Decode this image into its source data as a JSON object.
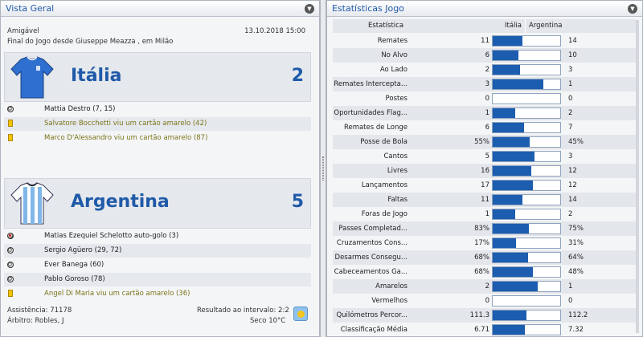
{
  "left": {
    "title": "Vista Geral",
    "competition": "Amigável",
    "datetime": "13.10.2018 15:00",
    "subtitle": "Final do Jogo desde Giuseppe Meazza , em Milão",
    "home": {
      "name": "Itália",
      "score": "2",
      "events": [
        {
          "type": "goal",
          "text": "Mattia Destro (7, 15)"
        },
        {
          "type": "yellow",
          "text": "Salvatore Bocchetti viu um cartão amarelo (42)"
        },
        {
          "type": "yellow",
          "text": "Marco D'Alessandro viu um cartão amarelo (87)"
        }
      ]
    },
    "away": {
      "name": "Argentina",
      "score": "5",
      "events": [
        {
          "type": "owngoal",
          "text": "Matias Ezequiel Schelotto auto-golo (3)"
        },
        {
          "type": "goal",
          "text": "Sergio Agüero (29, 72)"
        },
        {
          "type": "goal",
          "text": "Ever Banega (60)"
        },
        {
          "type": "goal",
          "text": "Pablo Goroso (78)"
        },
        {
          "type": "yellow",
          "text": "Angel Di Maria viu um cartão amarelo (36)"
        }
      ]
    },
    "attendance": "Assistência: 71178",
    "halftime": "Resultado ao intervalo: 2:2",
    "referee": "Árbitro: Robles, J",
    "weather": "Seco 10°C"
  },
  "right": {
    "title": "Estatísticas Jogo",
    "header": {
      "label": "Estatística",
      "home": "Itália",
      "away": "Argentina"
    },
    "rows": [
      {
        "label": "Remates",
        "home": "11",
        "away": "14",
        "share": 0.44
      },
      {
        "label": "No Alvo",
        "home": "6",
        "away": "10",
        "share": 0.38
      },
      {
        "label": "Ao Lado",
        "home": "2",
        "away": "3",
        "share": 0.4
      },
      {
        "label": "Remates Intercepta...",
        "home": "3",
        "away": "1",
        "share": 0.75
      },
      {
        "label": "Postes",
        "home": "0",
        "away": "0",
        "share": 0.0
      },
      {
        "label": "Oportunidades Flag...",
        "home": "1",
        "away": "2",
        "share": 0.33
      },
      {
        "label": "Remates de Longe",
        "home": "6",
        "away": "7",
        "share": 0.46
      },
      {
        "label": "Posse de Bola",
        "home": "55%",
        "away": "45%",
        "share": 0.55
      },
      {
        "label": "Cantos",
        "home": "5",
        "away": "3",
        "share": 0.62
      },
      {
        "label": "Livres",
        "home": "16",
        "away": "12",
        "share": 0.57
      },
      {
        "label": "Lançamentos",
        "home": "17",
        "away": "12",
        "share": 0.59
      },
      {
        "label": "Faltas",
        "home": "11",
        "away": "14",
        "share": 0.44
      },
      {
        "label": "Foras de Jogo",
        "home": "1",
        "away": "2",
        "share": 0.33
      },
      {
        "label": "Passes Completad...",
        "home": "83%",
        "away": "75%",
        "share": 0.53
      },
      {
        "label": "Cruzamentos Cons...",
        "home": "17%",
        "away": "31%",
        "share": 0.35
      },
      {
        "label": "Desarmes Consegu...",
        "home": "68%",
        "away": "64%",
        "share": 0.52
      },
      {
        "label": "Cabeceamentos Ga...",
        "home": "68%",
        "away": "48%",
        "share": 0.59
      },
      {
        "label": "Amarelos",
        "home": "2",
        "away": "1",
        "share": 0.67
      },
      {
        "label": "Vermelhos",
        "home": "0",
        "away": "0",
        "share": 0.0
      },
      {
        "label": "Quilómetros Percor...",
        "home": "111.3",
        "away": "112.2",
        "share": 0.5
      },
      {
        "label": "Classificação Média",
        "home": "6.71",
        "away": "7.32",
        "share": 0.48
      }
    ]
  },
  "icons": {
    "menu": "chevron-down-icon",
    "goal": "football-icon",
    "yellow": "yellow-card-icon",
    "weather": "sun-icon"
  },
  "colors": {
    "accent": "#1f5aa8",
    "bar": "#1c5db0",
    "card": "#f2c400"
  }
}
